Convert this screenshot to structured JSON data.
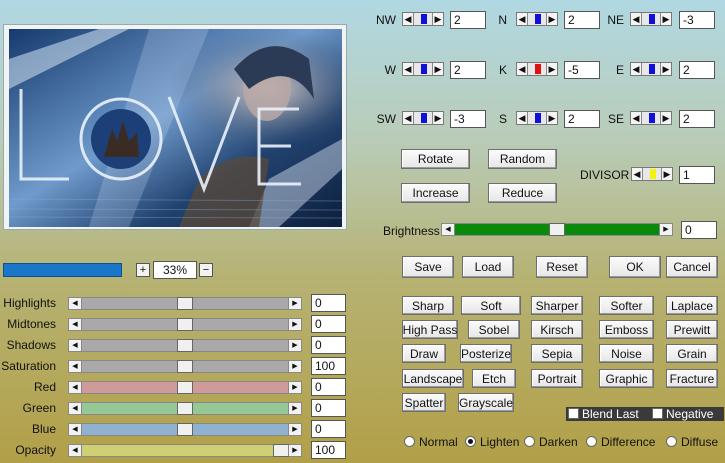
{
  "preview": {
    "alt_text": "LOVE"
  },
  "zoom": {
    "minus": "−",
    "plus": "+",
    "value": "33%"
  },
  "matrix": {
    "nw": {
      "label": "NW",
      "value": "2"
    },
    "n": {
      "label": "N",
      "value": "2"
    },
    "ne": {
      "label": "NE",
      "value": "-3"
    },
    "w": {
      "label": "W",
      "value": "2"
    },
    "k": {
      "label": "K",
      "value": "-5"
    },
    "e": {
      "label": "E",
      "value": "2"
    },
    "sw": {
      "label": "SW",
      "value": "-3"
    },
    "s": {
      "label": "S",
      "value": "2"
    },
    "se": {
      "label": "SE",
      "value": "2"
    }
  },
  "buttons": {
    "rotate": "Rotate",
    "random": "Random",
    "increase": "Increase",
    "reduce": "Reduce",
    "save": "Save",
    "load": "Load",
    "reset": "Reset",
    "ok": "OK",
    "cancel": "Cancel"
  },
  "divisor": {
    "label": "DIVISOR",
    "value": "1"
  },
  "brightness": {
    "label": "Brightness",
    "value": "0",
    "level": 0.5
  },
  "adjust": [
    {
      "label": "Highlights",
      "value": "0",
      "level": 0.5,
      "color": "#a9a9a9"
    },
    {
      "label": "Midtones",
      "value": "0",
      "level": 0.5,
      "color": "#a9a9a9"
    },
    {
      "label": "Shadows",
      "value": "0",
      "level": 0.5,
      "color": "#a9a9a9"
    },
    {
      "label": "Saturation",
      "value": "100",
      "level": 0.5,
      "color": "#a9a9a9"
    },
    {
      "label": "Red",
      "value": "0",
      "level": 0.5,
      "color": "#cf9a9a"
    },
    {
      "label": "Green",
      "value": "0",
      "level": 0.5,
      "color": "#96c896"
    },
    {
      "label": "Blue",
      "value": "0",
      "level": 0.5,
      "color": "#8fb2d0"
    },
    {
      "label": "Opacity",
      "value": "100",
      "level": 1.0,
      "color": "#cfcf74"
    }
  ],
  "presets": [
    [
      "Sharp",
      "Soft",
      "Sharper",
      "Softer",
      "Laplace"
    ],
    [
      "High Pass",
      "Sobel",
      "Kirsch",
      "Emboss",
      "Prewitt"
    ],
    [
      "Draw",
      "Posterize",
      "Sepia",
      "Noise",
      "Grain"
    ],
    [
      "Landscape",
      "Etch",
      "Portrait",
      "Graphic",
      "Fracture"
    ],
    [
      "Spatter",
      "Grayscale"
    ]
  ],
  "checkboxes": {
    "blend_last": "Blend Last",
    "negative": "Negative"
  },
  "blend_modes": [
    "Normal",
    "Lighten",
    "Darken",
    "Difference",
    "Diffuse"
  ],
  "selected_blend": "Lighten"
}
